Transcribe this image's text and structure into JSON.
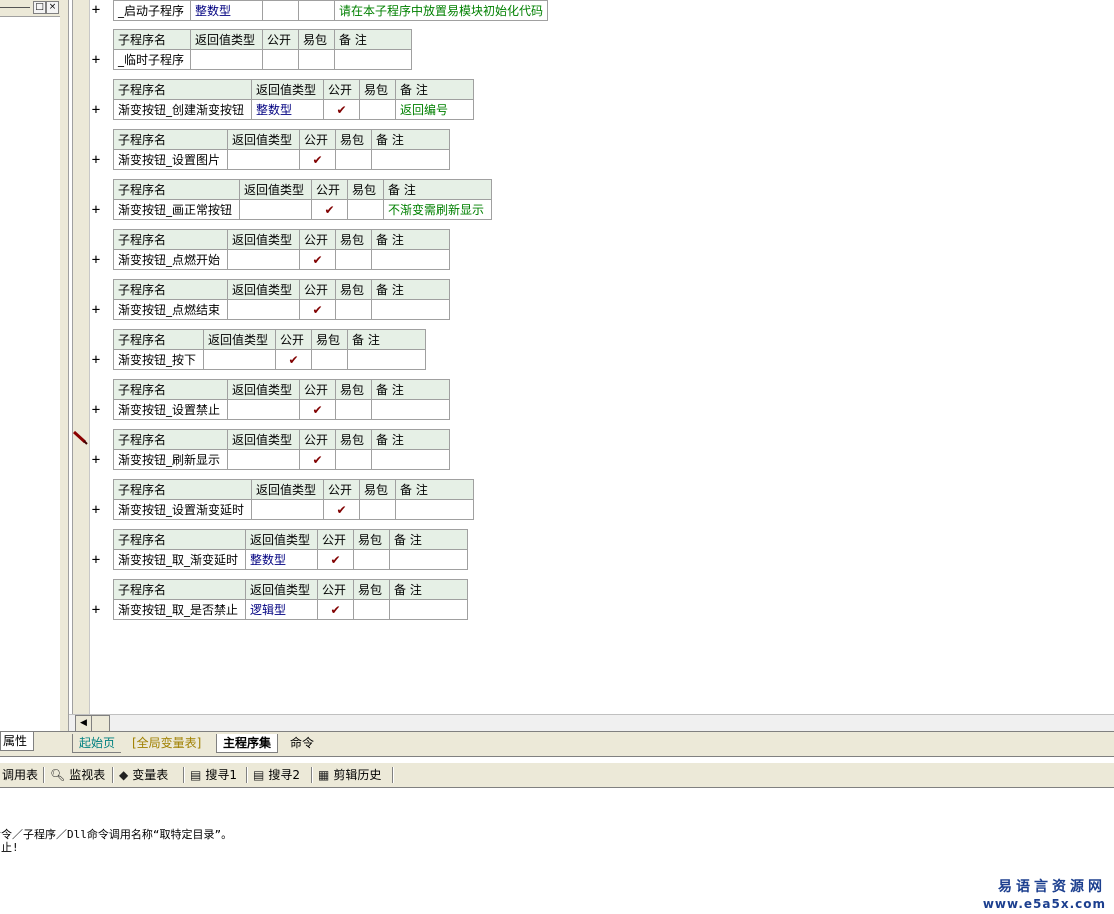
{
  "procedures": [
    {
      "hdr": {
        "name": "",
        "ret": "",
        "pub": "",
        "easy": "",
        "note": ""
      },
      "name": "_启动子程序",
      "ret": "整数型",
      "pub": "",
      "easy": "",
      "note": "请在本子程序中放置易模块初始化代码"
    },
    {
      "hdr": {
        "name": "子程序名",
        "ret": "返回值类型",
        "pub": "公开",
        "easy": "易包",
        "note": "备 注"
      },
      "name": "_临时子程序",
      "ret": "",
      "pub": "",
      "easy": "",
      "note": ""
    },
    {
      "hdr": {
        "name": "子程序名",
        "ret": "返回值类型",
        "pub": "公开",
        "easy": "易包",
        "note": "备 注"
      },
      "name": "渐变按钮_创建渐变按钮",
      "ret": "整数型",
      "pub": "✔",
      "easy": "",
      "note": "返回编号"
    },
    {
      "hdr": {
        "name": "子程序名",
        "ret": "返回值类型",
        "pub": "公开",
        "easy": "易包",
        "note": "备 注"
      },
      "name": "渐变按钮_设置图片",
      "ret": "",
      "pub": "✔",
      "easy": "",
      "note": ""
    },
    {
      "hdr": {
        "name": "子程序名",
        "ret": "返回值类型",
        "pub": "公开",
        "easy": "易包",
        "note": "备 注"
      },
      "name": "渐变按钮_画正常按钮",
      "ret": "",
      "pub": "✔",
      "easy": "",
      "note": "不渐变需刷新显示"
    },
    {
      "hdr": {
        "name": "子程序名",
        "ret": "返回值类型",
        "pub": "公开",
        "easy": "易包",
        "note": "备 注"
      },
      "name": "渐变按钮_点燃开始",
      "ret": "",
      "pub": "✔",
      "easy": "",
      "note": ""
    },
    {
      "hdr": {
        "name": "子程序名",
        "ret": "返回值类型",
        "pub": "公开",
        "easy": "易包",
        "note": "备 注"
      },
      "name": "渐变按钮_点燃结束",
      "ret": "",
      "pub": "✔",
      "easy": "",
      "note": ""
    },
    {
      "hdr": {
        "name": "子程序名",
        "ret": "返回值类型",
        "pub": "公开",
        "easy": "易包",
        "note": "备 注"
      },
      "name": "渐变按钮_按下",
      "ret": "",
      "pub": "✔",
      "easy": "",
      "note": ""
    },
    {
      "hdr": {
        "name": "子程序名",
        "ret": "返回值类型",
        "pub": "公开",
        "easy": "易包",
        "note": "备 注"
      },
      "name": "渐变按钮_设置禁止",
      "ret": "",
      "pub": "✔",
      "easy": "",
      "note": ""
    },
    {
      "hdr": {
        "name": "子程序名",
        "ret": "返回值类型",
        "pub": "公开",
        "easy": "易包",
        "note": "备 注"
      },
      "name": "渐变按钮_刷新显示",
      "ret": "",
      "pub": "✔",
      "easy": "",
      "note": ""
    },
    {
      "hdr": {
        "name": "子程序名",
        "ret": "返回值类型",
        "pub": "公开",
        "easy": "易包",
        "note": "备 注"
      },
      "name": "渐变按钮_设置渐变延时",
      "ret": "",
      "pub": "✔",
      "easy": "",
      "note": ""
    },
    {
      "hdr": {
        "name": "子程序名",
        "ret": "返回值类型",
        "pub": "公开",
        "easy": "易包",
        "note": "备 注"
      },
      "name": "渐变按钮_取_渐变延时",
      "ret": "整数型",
      "pub": "✔",
      "easy": "",
      "note": ""
    },
    {
      "hdr": {
        "name": "子程序名",
        "ret": "返回值类型",
        "pub": "公开",
        "easy": "易包",
        "note": "备 注"
      },
      "name": "渐变按钮_取_是否禁止",
      "ret": "逻辑型",
      "pub": "✔",
      "easy": "",
      "note": ""
    }
  ],
  "expand_symbol": "+",
  "left_panel": {
    "min_icon": "—",
    "restore_icon": "□",
    "close_icon": "×",
    "prop_tab": "属性"
  },
  "tabs": {
    "start": "起始页",
    "global": "[全局变量表]",
    "main": "主程序集",
    "cmd": "命令"
  },
  "toolbar": {
    "call": "调用表",
    "watch": "监视表",
    "vars": "变量表",
    "search1": "搜寻1",
    "search2": "搜寻2",
    "clip": "剪辑历史"
  },
  "output": {
    "line1": "命令／子程序／Dll命令调用名称“取特定目录”。",
    "line2": "中止!"
  },
  "watermark": {
    "title": "易语言资源网",
    "url": "www.e5a5x.com"
  },
  "colors": {
    "header_bg": "#e6f0e6",
    "type_text": "#000080",
    "note_text": "#008000",
    "check": "#800000",
    "watermark": "#1c3f8f"
  }
}
